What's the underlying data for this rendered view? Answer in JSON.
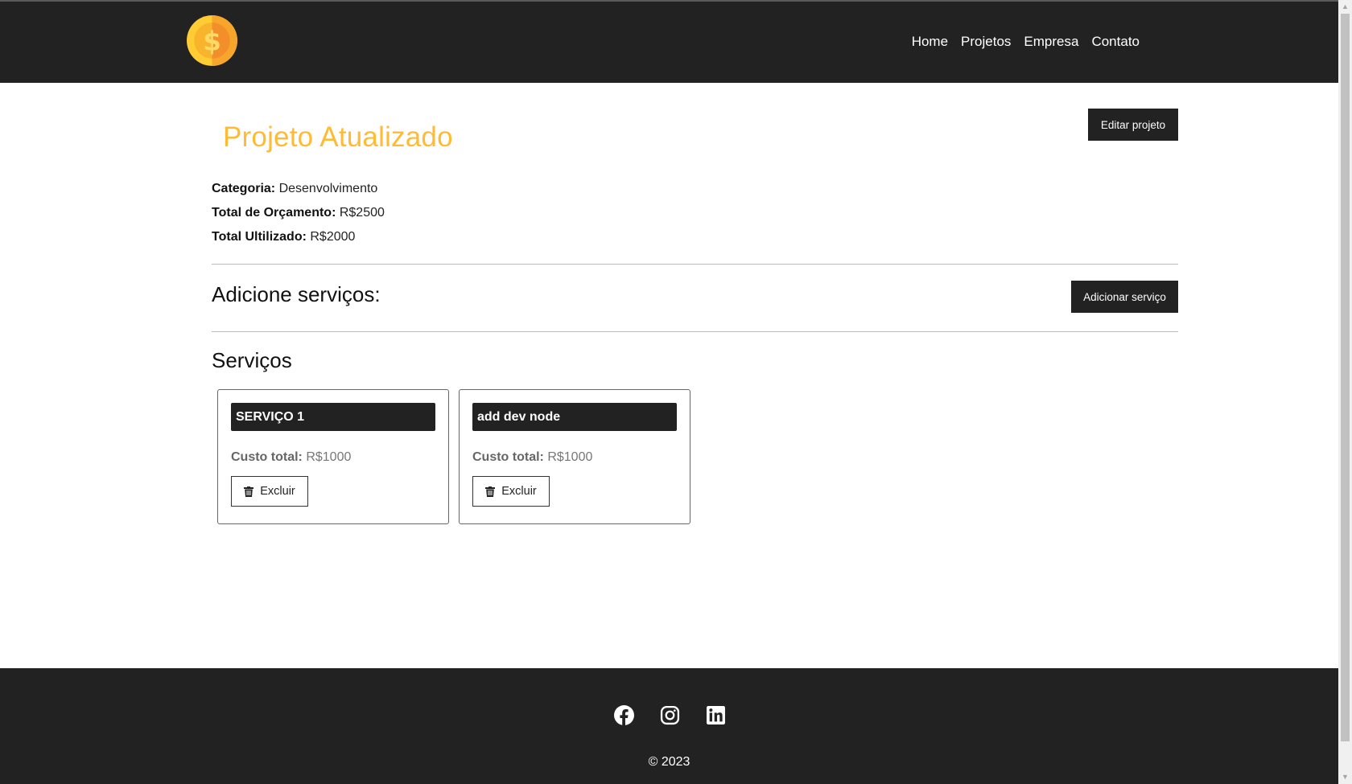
{
  "nav": {
    "logo_icon": "coin-dollar-icon",
    "links": [
      "Home",
      "Projetos",
      "Empresa",
      "Contato"
    ]
  },
  "project": {
    "title": "Projeto Atualizado",
    "edit_button": "Editar projeto",
    "category_label": "Categoria:",
    "category_value": "Desenvolvimento",
    "budget_label": "Total de Orçamento:",
    "budget_value": "R$2500",
    "used_label": "Total Ultilizado:",
    "used_value": "R$2000"
  },
  "add_services": {
    "title": "Adicione serviços:",
    "button": "Adicionar serviço"
  },
  "services": {
    "title": "Serviços",
    "items": [
      {
        "name": "SERVIÇO 1",
        "cost_label": "Custo total:",
        "cost_value": "R$1000",
        "delete_label": "Excluir"
      },
      {
        "name": "add dev node",
        "cost_label": "Custo total:",
        "cost_value": "R$1000",
        "delete_label": "Excluir"
      }
    ]
  },
  "footer": {
    "social_icons": [
      "facebook-icon",
      "instagram-icon",
      "linkedin-icon"
    ],
    "copyright": "© 2023"
  },
  "colors": {
    "dark": "#222222",
    "accent": "#ffbb33"
  }
}
